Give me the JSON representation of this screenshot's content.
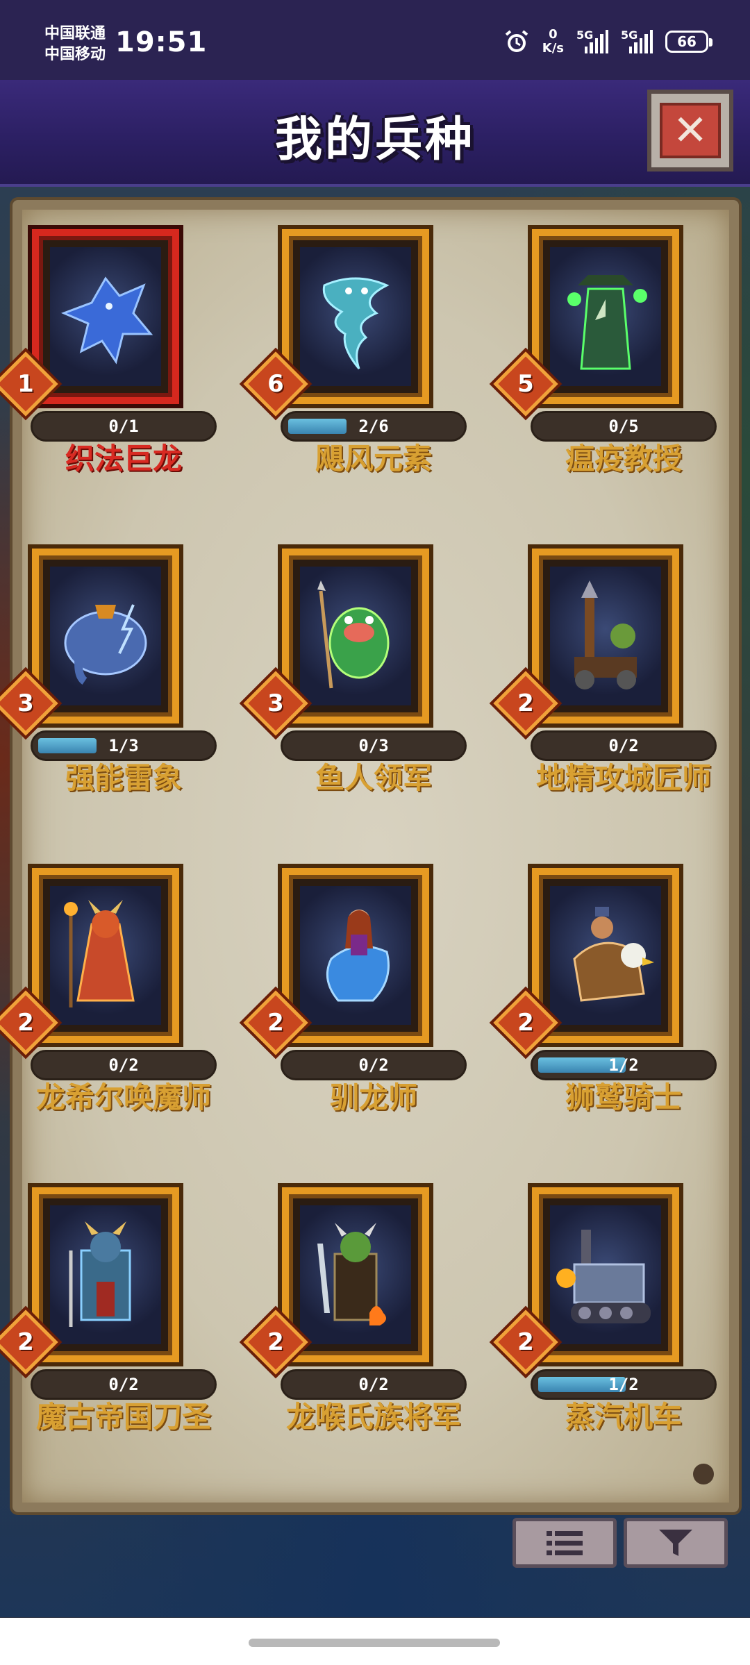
{
  "status_bar": {
    "carrier1": "中国联通",
    "carrier2": "中国移动",
    "time": "19:51",
    "net_speed_value": "0",
    "net_speed_unit": "K/s",
    "signal1_label": "5G",
    "signal2_label": "5G",
    "battery": "66"
  },
  "header": {
    "title": "我的兵种",
    "close_label": "✕"
  },
  "units": [
    {
      "name": "织法巨龙",
      "level": "1",
      "progress_text": "0/1",
      "progress": 0.0,
      "selected": true,
      "icon": "dragon-icon"
    },
    {
      "name": "飓风元素",
      "level": "6",
      "progress_text": "2/6",
      "progress": 0.333,
      "selected": false,
      "icon": "tornado-elemental-icon"
    },
    {
      "name": "瘟疫教授",
      "level": "5",
      "progress_text": "0/5",
      "progress": 0.0,
      "selected": false,
      "icon": "plague-doctor-icon"
    },
    {
      "name": "强能雷象",
      "level": "3",
      "progress_text": "1/3",
      "progress": 0.333,
      "selected": false,
      "icon": "thunder-elephant-icon"
    },
    {
      "name": "鱼人领军",
      "level": "3",
      "progress_text": "0/3",
      "progress": 0.0,
      "selected": false,
      "icon": "murloc-icon"
    },
    {
      "name": "地精攻城匠师",
      "level": "2",
      "progress_text": "0/2",
      "progress": 0.0,
      "selected": false,
      "icon": "goblin-siege-icon"
    },
    {
      "name": "龙希尔唤魔师",
      "level": "2",
      "progress_text": "0/2",
      "progress": 0.0,
      "selected": false,
      "icon": "dragonspawn-summoner-icon"
    },
    {
      "name": "驯龙师",
      "level": "2",
      "progress_text": "0/2",
      "progress": 0.0,
      "selected": false,
      "icon": "dragon-tamer-icon"
    },
    {
      "name": "狮鹫骑士",
      "level": "2",
      "progress_text": "1/2",
      "progress": 0.5,
      "selected": false,
      "icon": "gryphon-rider-icon"
    },
    {
      "name": "魔古帝国刀圣",
      "level": "2",
      "progress_text": "0/2",
      "progress": 0.0,
      "selected": false,
      "icon": "mogu-blademaster-icon"
    },
    {
      "name": "龙喉氏族将军",
      "level": "2",
      "progress_text": "0/2",
      "progress": 0.0,
      "selected": false,
      "icon": "orc-general-icon"
    },
    {
      "name": "蒸汽机车",
      "level": "2",
      "progress_text": "1/2",
      "progress": 0.5,
      "selected": false,
      "icon": "steam-tank-icon"
    }
  ],
  "footer": {
    "list_button_icon": "list-icon",
    "filter_button_icon": "filter-icon"
  },
  "colors": {
    "header_bg": "#2b1f62",
    "frame_gold": "#e69a22",
    "frame_selected": "#d6281e",
    "name_gold": "#d8a032",
    "name_selected": "#d82a22",
    "progress_fill": "#3a84b0"
  }
}
